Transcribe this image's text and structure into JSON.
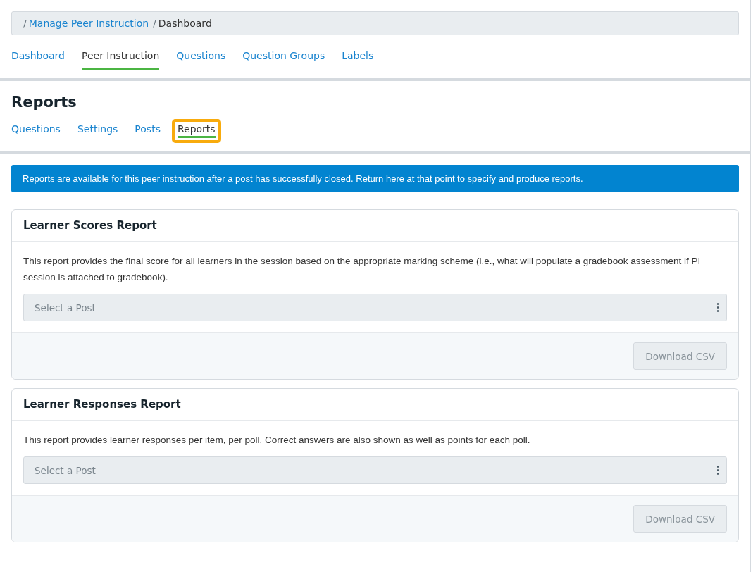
{
  "breadcrumb": [
    {
      "separator": "/",
      "label": "Manage Peer Instruction",
      "link": true
    },
    {
      "separator": "/",
      "label": "Dashboard",
      "link": false
    }
  ],
  "main_tabs": [
    {
      "label": "Dashboard",
      "selected": false
    },
    {
      "label": "Peer Instruction",
      "selected": true
    },
    {
      "label": "Questions",
      "selected": false
    },
    {
      "label": "Question Groups",
      "selected": false
    },
    {
      "label": "Labels",
      "selected": false
    }
  ],
  "page_title": "Reports",
  "sub_tabs": [
    {
      "label": "Questions",
      "selected": false,
      "focused": false
    },
    {
      "label": "Settings",
      "selected": false,
      "focused": false
    },
    {
      "label": "Posts",
      "selected": false,
      "focused": false
    },
    {
      "label": "Reports",
      "selected": true,
      "focused": true
    }
  ],
  "info_banner": "Reports are available for this peer instruction after a post has successfully closed. Return here at that point to specify and produce reports.",
  "reports": [
    {
      "title": "Learner Scores Report",
      "description": "This report provides the final score for all learners in the session based on the appropriate marking scheme (i.e., what will populate a gradebook assessment if PI session is attached to gradebook).",
      "select": {
        "placeholder": "Select a Post"
      },
      "button": {
        "label": "Download CSV",
        "disabled": true
      }
    },
    {
      "title": "Learner Responses Report",
      "description": "This report provides learner responses per item, per poll. Correct answers are also shown as well as points for each poll.",
      "select": {
        "placeholder": "Select a Post"
      },
      "button": {
        "label": "Download CSV",
        "disabled": true
      }
    }
  ]
}
